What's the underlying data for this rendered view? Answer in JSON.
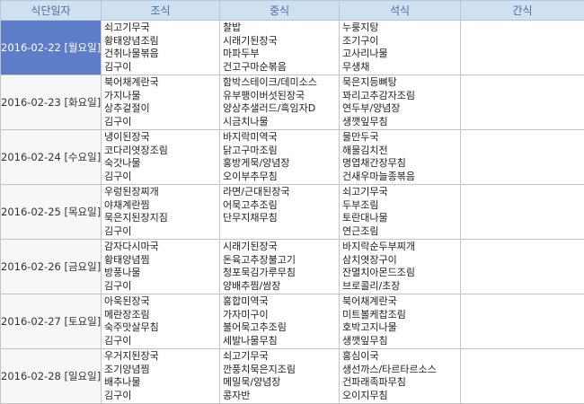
{
  "header": {
    "date": "식단일자",
    "breakfast": "조식",
    "lunch": "중식",
    "dinner": "석식",
    "snack": "간식"
  },
  "colors": {
    "header_bg": "#cfe0f1",
    "header_text": "#4a6ea0",
    "selected_bg": "#5e7dc9",
    "selected_text": "#ffffff"
  },
  "rows": [
    {
      "date": "2016-02-22 [월요일]",
      "selected": true,
      "breakfast": [
        "쇠고기무국",
        "황태양념조림",
        "건취나물볶음",
        "김구이"
      ],
      "lunch": [
        "찰밥",
        "시래기된장국",
        "마파두부",
        "건고구마순볶음"
      ],
      "dinner": [
        "누룽지탕",
        "조기구이",
        "고사리나물",
        "무생채"
      ],
      "snack": []
    },
    {
      "date": "2016-02-23 [화요일]",
      "selected": false,
      "breakfast": [
        "북어채계란국",
        "가지나물",
        "상추겉절이",
        "김구이"
      ],
      "lunch": [
        "함박스테이크/데미소스",
        "유부팽이버섯된장국",
        "양상추샐러드/흑임자D",
        "시금치나물"
      ],
      "dinner": [
        "묵은지등뼈탕",
        "꽈리고추감자조림",
        "연두부/양념장",
        "생깻잎무침"
      ],
      "snack": []
    },
    {
      "date": "2016-02-24 [수요일]",
      "selected": false,
      "breakfast": [
        "냉이된장국",
        "코다리엿장조림",
        "숙갓나물",
        "김구이"
      ],
      "lunch": [
        "바지락미역국",
        "닭고구마조림",
        "홍방게묵/양념장",
        "오이부추무침"
      ],
      "dinner": [
        "물만두국",
        "해물김치전",
        "명엽채간장무침",
        "건새우마늘종볶음"
      ],
      "snack": []
    },
    {
      "date": "2016-02-25 [목요일]",
      "selected": false,
      "breakfast": [
        "우렁된장찌개",
        "야채계란찜",
        "묵은지된장지짐",
        "김구이"
      ],
      "lunch": [
        "라면/근대된장국",
        "어묵고추조림",
        "단무지채무침"
      ],
      "dinner": [
        "쇠고기무국",
        "두부조림",
        "토란대나물",
        "연근조림"
      ],
      "snack": []
    },
    {
      "date": "2016-02-26 [금요일]",
      "selected": false,
      "breakfast": [
        "감자다시마국",
        "황태양념찜",
        "방풍나물",
        "김구이"
      ],
      "lunch": [
        "시래기된장국",
        "돈육고추장불고기",
        "청포묵김가루무침",
        "양배추찜/쌈장"
      ],
      "dinner": [
        "바지락순두부찌개",
        "삼치엿장구이",
        "잔멸치아몬드조림",
        "브로콜리/초장"
      ],
      "snack": []
    },
    {
      "date": "2016-02-27 [토요일]",
      "selected": false,
      "breakfast": [
        "아욱된장국",
        "메란장조림",
        "숙주맛살무침",
        "김구이"
      ],
      "lunch": [
        "홍합미역국",
        "가자미구이",
        "불어묵고추조림",
        "세발나물무침"
      ],
      "dinner": [
        "북어채계란국",
        "미트볼케찹조림",
        "호박고지나물",
        "생깻잎무침"
      ],
      "snack": []
    },
    {
      "date": "2016-02-28 [일요일]",
      "selected": false,
      "breakfast": [
        "우거지된장국",
        "조기양념찜",
        "배추나물",
        "김구이"
      ],
      "lunch": [
        "쇠고기무국",
        "깐풍치묵은지조림",
        "메밀묵/양념장",
        "콩자반"
      ],
      "dinner": [
        "홍심이국",
        "생선까스/타르타르소스",
        "건파래족파무침",
        "오이지무침"
      ],
      "snack": []
    }
  ]
}
